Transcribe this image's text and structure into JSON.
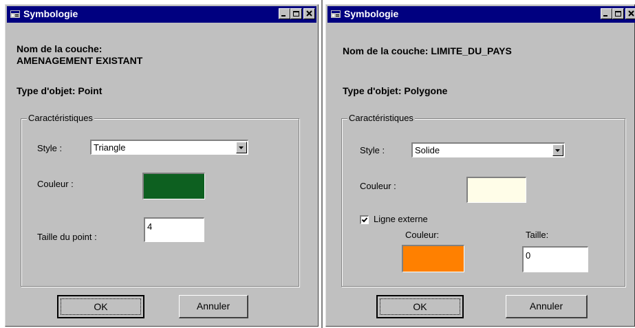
{
  "dialogs": [
    {
      "title": "Symbologie",
      "layer_label": "Nom de la couche:",
      "layer_name": "AMENAGEMENT  EXISTANT",
      "object_type": "Type d'objet: Point",
      "group_label": "Caractéristiques",
      "style_label": "Style :",
      "style_value": "Triangle",
      "color_label": "Couleur :",
      "color_value": "#0d6020",
      "size_label": "Taille du point :",
      "size_value": "4",
      "ok_label": "OK",
      "cancel_label": "Annuler"
    },
    {
      "title": "Symbologie",
      "layer_label_full": "Nom de la couche: LIMITE_DU_PAYS",
      "object_type": "Type d'objet: Polygone",
      "group_label": "Caractéristiques",
      "style_label": "Style :",
      "style_value": "Solide",
      "color_label": "Couleur :",
      "color_value": "#fffde8",
      "outline_label": "Ligne externe",
      "outline_checked": true,
      "outline_color_label": "Couleur:",
      "outline_color_value": "#ff8000",
      "outline_size_label": "Taille:",
      "outline_size_value": "0",
      "ok_label": "OK",
      "cancel_label": "Annuler"
    }
  ]
}
